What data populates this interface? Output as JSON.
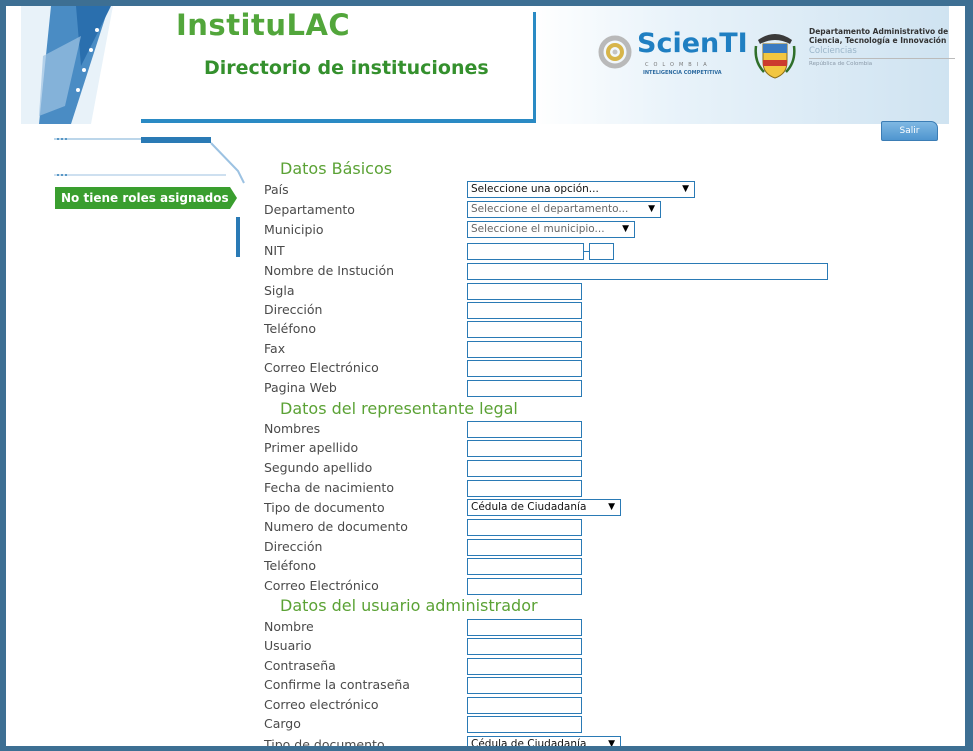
{
  "header": {
    "app_title": "InstituLAC",
    "app_subtitle": "Directorio de instituciones",
    "scienti_name": "ScienTI",
    "scienti_country": "COLOMBIA",
    "scienti_tagline": "INTELIGENCIA COMPETITIVA",
    "dept_line1": "Departamento Administrativo de",
    "dept_line2": "Ciencia, Tecnología e Innovación",
    "dept_line3": "Colciencias",
    "dept_line4": "República de Colombia",
    "logout_label": "Salir"
  },
  "sidebar": {
    "roles_message": "No tiene roles asignados"
  },
  "sections": {
    "basic": "Datos Básicos",
    "legal_rep": "Datos del representante legal",
    "admin_user": "Datos del usuario administrador"
  },
  "basic_fields": {
    "country_label": "País",
    "country_value": "Seleccione una opción...",
    "department_label": "Departamento",
    "department_value": "Seleccione el departamento...",
    "municipality_label": "Municipio",
    "municipality_value": "Seleccione el municipio...",
    "nit_label": "NIT",
    "institution_name_label": "Nombre de Instución",
    "acronym_label": "Sigla",
    "address_label": "Dirección",
    "phone_label": "Teléfono",
    "fax_label": "Fax",
    "email_label": "Correo Electrónico",
    "website_label": "Pagina Web"
  },
  "legal_fields": {
    "first_names_label": "Nombres",
    "first_surname_label": "Primer apellido",
    "second_surname_label": "Segundo apellido",
    "birth_date_label": "Fecha de nacimiento",
    "doc_type_label": "Tipo de documento",
    "doc_type_value": "Cédula de Ciudadanía",
    "doc_number_label": "Numero de documento",
    "address_label": "Dirección",
    "phone_label": "Teléfono",
    "email_label": "Correo Electrónico"
  },
  "admin_fields": {
    "name_label": "Nombre",
    "user_label": "Usuario",
    "password_label": "Contraseña",
    "confirm_password_label": "Confirme la contraseña",
    "email_label": "Correo electrónico",
    "position_label": "Cargo",
    "doc_type_label": "Tipo de documento",
    "doc_type_value": "Cédula de Ciudadanía"
  },
  "colors": {
    "frame_border": "#3d6f93",
    "title_green": "#52a63b",
    "section_green": "#5ba235",
    "field_border": "#2a7ab5",
    "roles_tag": "#3a9e2f"
  },
  "icons": {
    "dropdown": "triangle-down"
  }
}
